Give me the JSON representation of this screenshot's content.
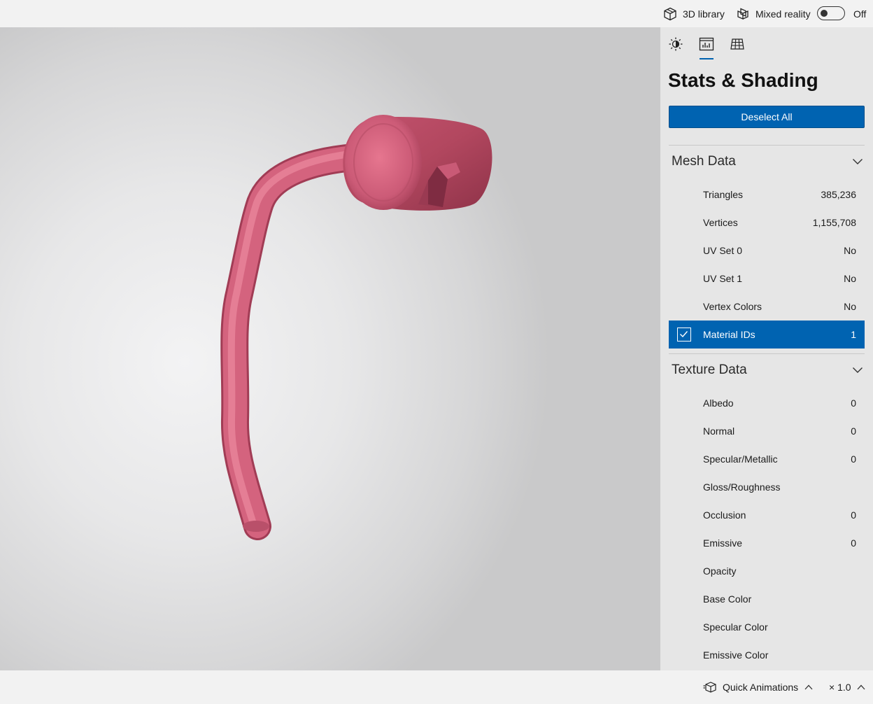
{
  "topbar": {
    "library_label": "3D library",
    "mixed_reality_label": "Mixed reality",
    "toggle_state": "Off"
  },
  "panel": {
    "tabs": [
      {
        "icon": "lighting-icon"
      },
      {
        "icon": "stats-icon",
        "active": true
      },
      {
        "icon": "grid-icon"
      }
    ],
    "title": "Stats & Shading",
    "deselect_label": "Deselect All",
    "mesh": {
      "heading": "Mesh Data",
      "rows": [
        {
          "label": "Triangles",
          "value": "385,236"
        },
        {
          "label": "Vertices",
          "value": "1,155,708"
        },
        {
          "label": "UV Set 0",
          "value": "No"
        },
        {
          "label": "UV Set 1",
          "value": "No"
        },
        {
          "label": "Vertex Colors",
          "value": "No"
        },
        {
          "label": "Material IDs",
          "value": "1"
        }
      ]
    },
    "texture": {
      "heading": "Texture Data",
      "rows": [
        {
          "label": "Albedo",
          "value": "0"
        },
        {
          "label": "Normal",
          "value": "0"
        },
        {
          "label": "Specular/Metallic",
          "value": "0"
        },
        {
          "label": "Gloss/Roughness",
          "value": ""
        },
        {
          "label": "Occlusion",
          "value": "0"
        },
        {
          "label": "Emissive",
          "value": "0"
        },
        {
          "label": "Opacity",
          "value": ""
        },
        {
          "label": "Base Color",
          "value": ""
        },
        {
          "label": "Specular Color",
          "value": ""
        },
        {
          "label": "Emissive Color",
          "value": ""
        }
      ]
    }
  },
  "bottombar": {
    "animations_label": "Quick Animations",
    "speed_label": "× 1.0"
  },
  "colors": {
    "accent": "#0063b1",
    "model": "#d4637e"
  }
}
